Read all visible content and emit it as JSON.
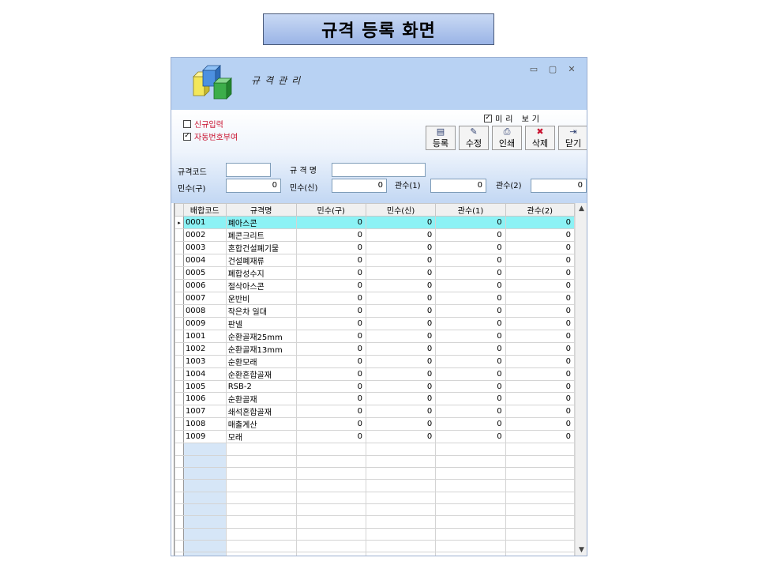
{
  "slide_title": "규격 등록 화면",
  "window": {
    "title": "규격관리",
    "controls": {
      "minimize": "▭",
      "maximize": "▢",
      "close": "✕"
    }
  },
  "options": {
    "new_input": {
      "label": "신규입력",
      "checked": false
    },
    "auto_number": {
      "label": "자동번호부여",
      "checked": true
    },
    "preview": {
      "label": "미리 보기",
      "checked": true
    }
  },
  "toolbar": [
    {
      "name": "register-button",
      "icon": "register-icon",
      "glyph": "▤",
      "label": "등록"
    },
    {
      "name": "edit-button",
      "icon": "edit-icon",
      "glyph": "✎",
      "label": "수정"
    },
    {
      "name": "print-button",
      "icon": "printer-icon",
      "glyph": "⎙",
      "label": "인쇄"
    },
    {
      "name": "delete-button",
      "icon": "delete-icon",
      "glyph": "✖",
      "label": "삭제"
    },
    {
      "name": "close-button",
      "icon": "exit-door-icon",
      "glyph": "⇥",
      "label": "닫기"
    }
  ],
  "form": {
    "code_label": "규격코드",
    "code_value": "",
    "name_label": "규 격 명",
    "name_value": "",
    "mins_old_label": "민수(구)",
    "mins_old_value": "0",
    "mins_new_label": "민수(신)",
    "mins_new_value": "0",
    "gwan1_label": "관수(1)",
    "gwan1_value": "0",
    "gwan2_label": "관수(2)",
    "gwan2_value": "0"
  },
  "grid": {
    "columns": [
      "배합코드",
      "규격명",
      "민수(구)",
      "민수(신)",
      "관수(1)",
      "관수(2)"
    ],
    "selected_index": 0,
    "row_indicator": "▸",
    "rows": [
      [
        "0001",
        "폐아스콘",
        "0",
        "0",
        "0",
        "0"
      ],
      [
        "0002",
        "폐콘크리트",
        "0",
        "0",
        "0",
        "0"
      ],
      [
        "0003",
        "혼합건설폐기물",
        "0",
        "0",
        "0",
        "0"
      ],
      [
        "0004",
        "건설폐재류",
        "0",
        "0",
        "0",
        "0"
      ],
      [
        "0005",
        "폐합성수지",
        "0",
        "0",
        "0",
        "0"
      ],
      [
        "0006",
        "절삭아스콘",
        "0",
        "0",
        "0",
        "0"
      ],
      [
        "0007",
        "운반비",
        "0",
        "0",
        "0",
        "0"
      ],
      [
        "0008",
        "작은차 일대",
        "0",
        "0",
        "0",
        "0"
      ],
      [
        "0009",
        "판넬",
        "0",
        "0",
        "0",
        "0"
      ],
      [
        "1001",
        "순환골재25mm",
        "0",
        "0",
        "0",
        "0"
      ],
      [
        "1002",
        "순환골재13mm",
        "0",
        "0",
        "0",
        "0"
      ],
      [
        "1003",
        "순환모래",
        "0",
        "0",
        "0",
        "0"
      ],
      [
        "1004",
        "순환혼합골재",
        "0",
        "0",
        "0",
        "0"
      ],
      [
        "1005",
        "RSB-2",
        "0",
        "0",
        "0",
        "0"
      ],
      [
        "1006",
        "순환골재",
        "0",
        "0",
        "0",
        "0"
      ],
      [
        "1007",
        "쇄석혼합골재",
        "0",
        "0",
        "0",
        "0"
      ],
      [
        "1008",
        "매출계산",
        "0",
        "0",
        "0",
        "0"
      ],
      [
        "1009",
        "모래",
        "0",
        "0",
        "0",
        "0"
      ]
    ],
    "empty_rows": 10,
    "scroll_up": "▲",
    "scroll_down": "▼"
  },
  "colors": {
    "header_bg": "#b8d2f3",
    "selected_row": "#8cf2f5",
    "code_column_empty": "#d6e6f7",
    "option_text": "#c8102e"
  }
}
